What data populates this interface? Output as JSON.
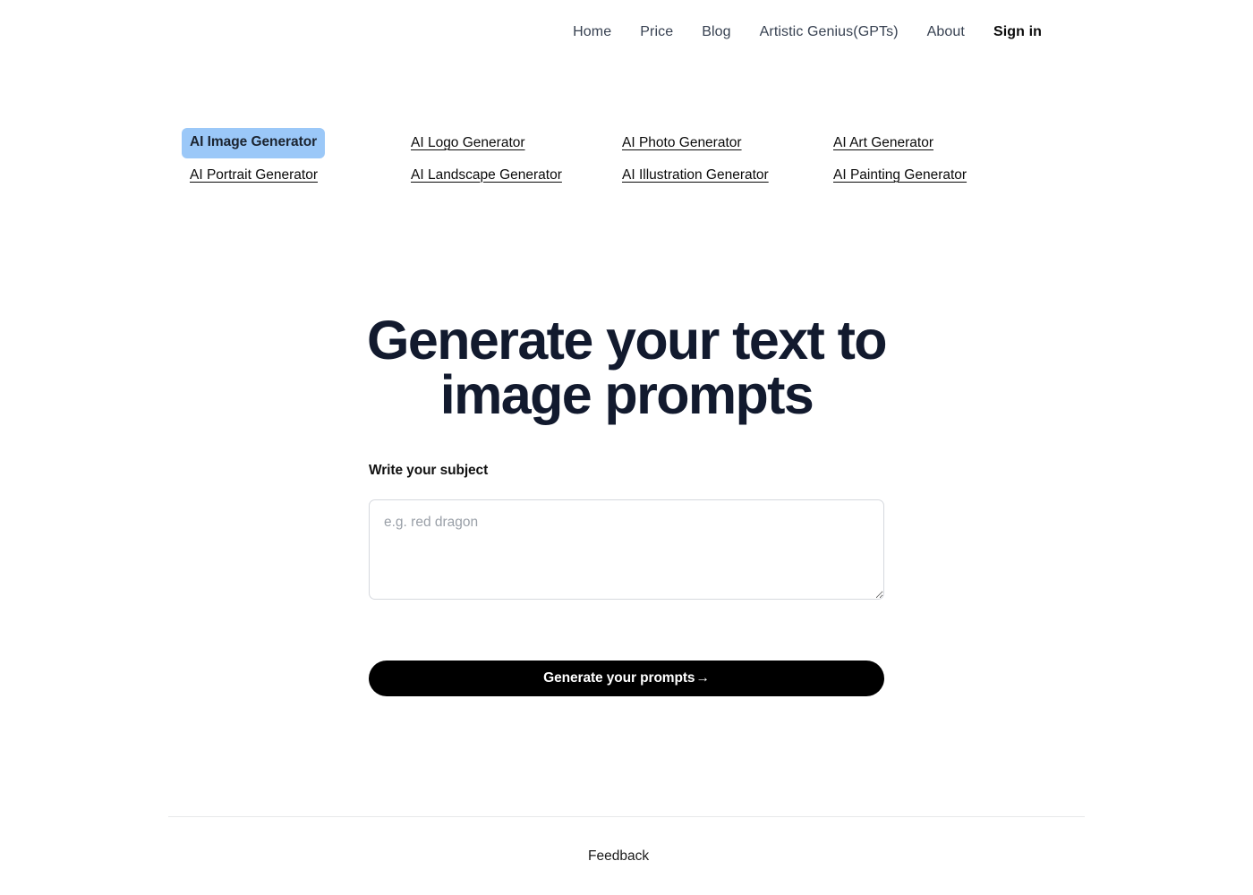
{
  "nav": {
    "items": [
      {
        "label": "Home",
        "emphasis": "normal"
      },
      {
        "label": "Price",
        "emphasis": "normal"
      },
      {
        "label": "Blog",
        "emphasis": "normal"
      },
      {
        "label": "Artistic Genius(GPTs)",
        "emphasis": "normal"
      },
      {
        "label": "About",
        "emphasis": "normal"
      },
      {
        "label": "Sign in",
        "emphasis": "bold"
      }
    ]
  },
  "generator_links": [
    {
      "label": "AI Image Generator",
      "active": true
    },
    {
      "label": "AI Logo Generator",
      "active": false
    },
    {
      "label": "AI Photo Generator",
      "active": false
    },
    {
      "label": "AI Art Generator",
      "active": false
    },
    {
      "label": "AI Portrait Generator",
      "active": false
    },
    {
      "label": "AI Landscape Generator",
      "active": false
    },
    {
      "label": "AI Illustration Generator",
      "active": false
    },
    {
      "label": "AI Painting Generator",
      "active": false
    }
  ],
  "hero": {
    "line1": "Generate your text to",
    "line2": "image prompts"
  },
  "form": {
    "label": "Write your subject",
    "placeholder": "e.g. red dragon",
    "value": "",
    "submit_label": "Generate your prompts",
    "submit_arrow": "→"
  },
  "footer": {
    "feedback_label": "Feedback"
  },
  "colors": {
    "accent_highlight": "#9bc8f8",
    "heading": "#121a2e",
    "button_bg": "#000000",
    "nav_text": "#374151",
    "divider": "#e7e8ea"
  }
}
